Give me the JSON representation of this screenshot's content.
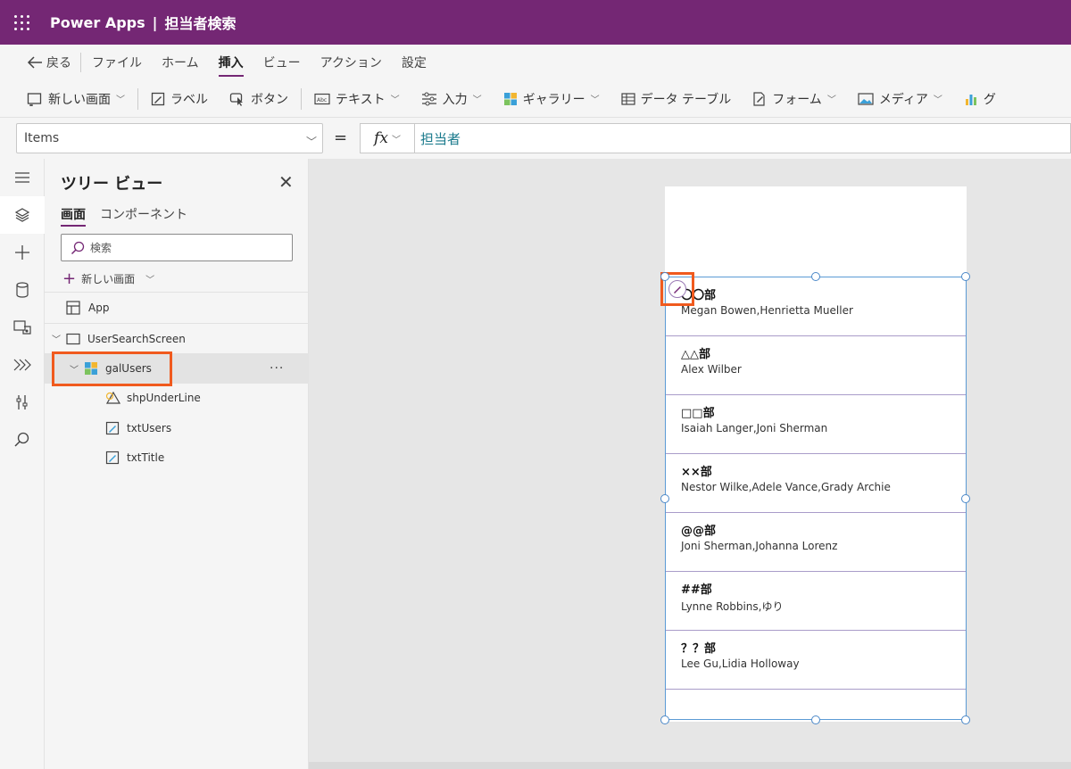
{
  "titlebar": {
    "app_name": "Power Apps",
    "separator": "|",
    "app_title": "担当者検索"
  },
  "menubar": {
    "back": "戻る",
    "items": [
      "ファイル",
      "ホーム",
      "挿入",
      "ビュー",
      "アクション",
      "設定"
    ],
    "active_index": 2
  },
  "ribbon": {
    "new_screen": "新しい画面",
    "label": "ラベル",
    "button": "ボタン",
    "text": "テキスト",
    "input": "入力",
    "gallery": "ギャラリー",
    "data_table": "データ テーブル",
    "form": "フォーム",
    "media": "メディア",
    "chart": "グ"
  },
  "formula": {
    "property": "Items",
    "equals": "=",
    "fx": "fx",
    "value": "担当者"
  },
  "tree": {
    "title": "ツリー ビュー",
    "tabs": [
      "画面",
      "コンポーネント"
    ],
    "search_placeholder": "検索",
    "new_screen": "新しい画面",
    "app": "App",
    "screen": "UserSearchScreen",
    "gallery": "galUsers",
    "more": "···",
    "children": [
      "shpUnderLine",
      "txtUsers",
      "txtTitle"
    ]
  },
  "gallery_rows": [
    {
      "title": "〇〇部",
      "users": "Megan Bowen,Henrietta Mueller"
    },
    {
      "title": "△△部",
      "users": "Alex Wilber"
    },
    {
      "title": "□□部",
      "users": "Isaiah Langer,Joni Sherman"
    },
    {
      "title": "××部",
      "users": "Nestor Wilke,Adele Vance,Grady Archie"
    },
    {
      "title": "@@部",
      "users": "Joni Sherman,Johanna Lorenz"
    },
    {
      "title": "##部",
      "users": "Lynne Robbins,ゆり"
    },
    {
      "title": "？？部",
      "users": "Lee Gu,Lidia Holloway"
    }
  ],
  "colors": {
    "brand": "#742774",
    "highlight": "#f05a1e",
    "selection": "#5b9bd5",
    "formula_text": "#1a7a8c"
  }
}
